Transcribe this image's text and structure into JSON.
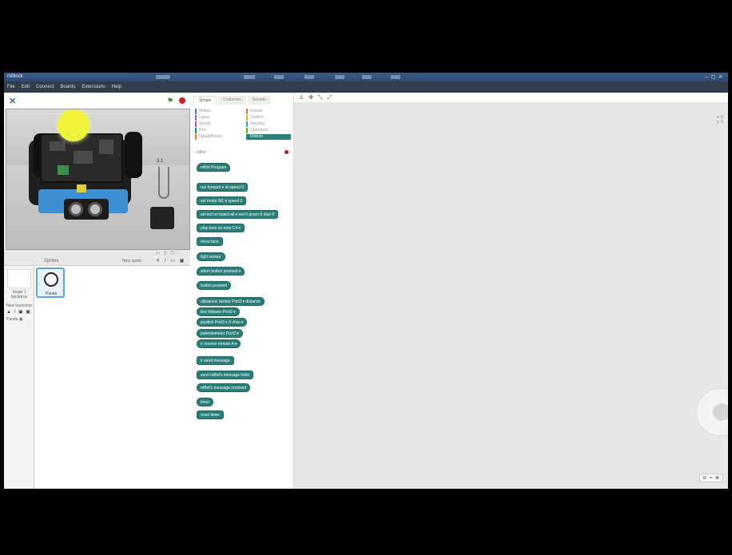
{
  "window": {
    "title": "mBlock",
    "controls": "– ▢ ✕"
  },
  "menu": [
    "File",
    "Edit",
    "Connect",
    "Boards",
    "Extensions",
    "Help"
  ],
  "stage_toolbar": {
    "logo": "✕",
    "flag": "⚑"
  },
  "stage": {
    "cable_label": "3.1"
  },
  "sprites": {
    "header": "Sprites",
    "new_sprite": "New sprite:",
    "tools": "⚘ / ▭ ▣",
    "stage_controls": "▭ ▯ ▢",
    "stage_thumb_label": "Stage 1 backdrop",
    "new_backdrop": "New backdrop:",
    "backdrop_tools": "▲ / ▣ ▣",
    "new_backdrop_extra": "Panda ▣",
    "panda_label": "Panda"
  },
  "palette": {
    "tabs": [
      "Scripts",
      "Costumes",
      "Sounds"
    ],
    "active_tab": 0,
    "categories": [
      {
        "label": "Motion",
        "color": "#4a6cd4"
      },
      {
        "label": "Looks",
        "color": "#8a55d7"
      },
      {
        "label": "Sound",
        "color": "#bb42c3"
      },
      {
        "label": "Pen",
        "color": "#0e9a6c"
      },
      {
        "label": "Data&Blocks",
        "color": "#ee7d16"
      },
      {
        "label": "Events",
        "color": "#c88330"
      },
      {
        "label": "Control",
        "color": "#e1a91a"
      },
      {
        "label": "Sensing",
        "color": "#2ca5e2"
      },
      {
        "label": "Operators",
        "color": "#5cb712"
      },
      {
        "label": "Robots",
        "color": "#2b7f79"
      }
    ],
    "selected_category": "Robots",
    "robot_title": "mBot",
    "blocks": [
      {
        "label": "mBot Program",
        "kind": "hat"
      },
      {
        "label": "run forward ▾ at speed 0",
        "kind": "stack"
      },
      {
        "label": "set motor M1 ▾ speed 0",
        "kind": "stack"
      },
      {
        "label": "set led on board all ▾ red 0 green 0 blue 0",
        "kind": "stack"
      },
      {
        "label": "play tone on note C4 ▾",
        "kind": "stack"
      },
      {
        "label": "show face",
        "kind": "stack"
      },
      {
        "label": "light sensor",
        "kind": "reporter"
      },
      {
        "label": "when button pressed ▾",
        "kind": "hat"
      },
      {
        "label": "button pressed",
        "kind": "reporter"
      },
      {
        "label": "ultrasonic sensor Port3 ▾ distance",
        "kind": "reporter"
      },
      {
        "label": "line follower Port2 ▾",
        "kind": "reporter"
      },
      {
        "label": "joystick Port3 ▾ X-Axis ▾",
        "kind": "reporter"
      },
      {
        "label": "potentiometer Port3 ▾",
        "kind": "reporter"
      },
      {
        "label": "ir receive remote A ▾",
        "kind": "reporter"
      },
      {
        "label": "ir send message",
        "kind": "stack"
      },
      {
        "label": "send mBot's message hello",
        "kind": "stack"
      },
      {
        "label": "mBot's message received",
        "kind": "reporter"
      },
      {
        "label": "timer",
        "kind": "reporter"
      },
      {
        "label": "reset timer",
        "kind": "stack"
      }
    ]
  },
  "scripts": {
    "tools": "♙ ✥ ⤡ ⤢",
    "coords": "x: 0\ny: 0",
    "zoom": "⊖ = ⊕"
  }
}
